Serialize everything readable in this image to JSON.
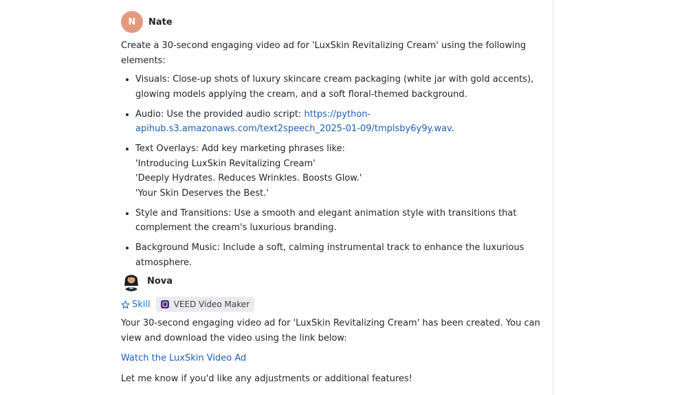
{
  "user_message": {
    "avatar_letter": "N",
    "name": "Nate",
    "intro": "Create a 30-second engaging video ad for 'LuxSkin Revitalizing Cream' using the following elements:",
    "bullets": {
      "visuals": "Visuals: Close-up shots of luxury skincare cream packaging (white jar with gold accents), glowing models applying the cream, and a soft floral-themed background.",
      "audio_prefix": "Audio: Use the provided audio script: ",
      "audio_link": "https://python-apihub.s3.amazonaws.com/text2speech_2025-01-09/tmplsby6y9y.wav",
      "audio_suffix": ".",
      "text_overlays_title": "Text Overlays: Add key marketing phrases like:",
      "overlay_1": "'Introducing LuxSkin Revitalizing Cream'",
      "overlay_2": "'Deeply Hydrates. Reduces Wrinkles. Boosts Glow.'",
      "overlay_3": "'Your Skin Deserves the Best.'",
      "style": "Style and Transitions: Use a smooth and elegant animation style with transitions that complement the cream's luxurious branding.",
      "music": "Background Music: Include a soft, calming instrumental track to enhance the luxurious atmosphere."
    }
  },
  "bot_message": {
    "name": "Nova",
    "skill_label": "Skill",
    "tool_label": "VEED Video Maker",
    "response": "Your 30-second engaging video ad for 'LuxSkin Revitalizing Cream' has been created. You can view and download the video using the link below:",
    "video_link": "Watch the LuxSkin Video Ad",
    "closing": "Let me know if you'd like any adjustments or additional features!"
  },
  "colors": {
    "user_avatar": "#e29a7f",
    "link": "#1a5fb4",
    "skill": "#1a73c8",
    "tool_badge_bg": "#e8eaed"
  },
  "icons": {
    "skill": "sparkle-star-icon",
    "tool": "veed-app-icon"
  }
}
